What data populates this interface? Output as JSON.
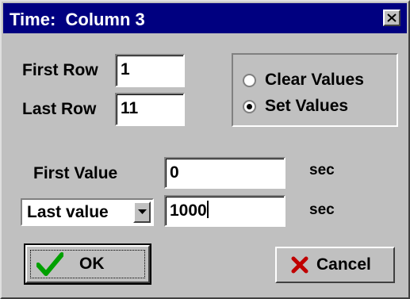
{
  "window": {
    "title": "Time:  Column 3"
  },
  "rows": {
    "first_row_label": "First Row",
    "first_row_value": "1",
    "last_row_label": "Last Row",
    "last_row_value": "11"
  },
  "mode": {
    "clear_label": "Clear Values",
    "set_label": "Set Values",
    "selected": "Set Values"
  },
  "values": {
    "first_value_label": "First Value",
    "first_value": "0",
    "first_unit": "sec",
    "last_select_value": "Last value",
    "last_value": "1000",
    "last_unit": "sec"
  },
  "buttons": {
    "ok_label": "OK",
    "cancel_label": "Cancel"
  },
  "colors": {
    "titlebar": "#000080",
    "face": "#c0c0c0",
    "ok_check": "#00a000",
    "cancel_x": "#c00000"
  },
  "icons": {
    "close": "close-icon",
    "ok": "checkmark-icon",
    "cancel": "red-x-icon",
    "dropdown": "chevron-down-icon"
  }
}
